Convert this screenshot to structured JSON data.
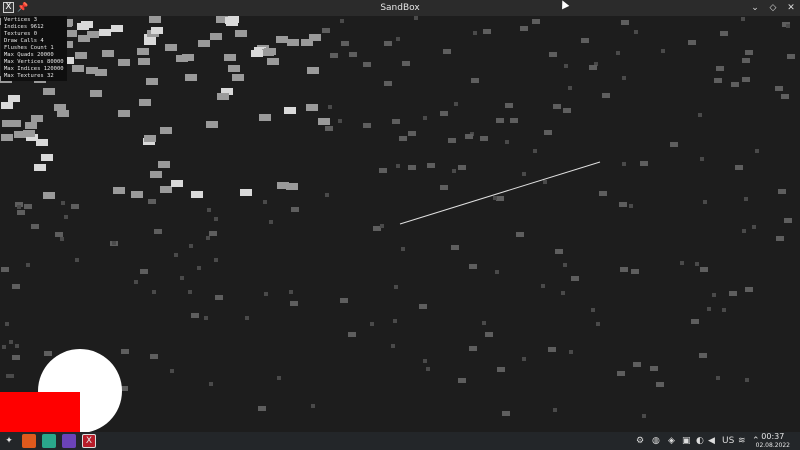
{
  "window": {
    "title": "SandBox",
    "app_icon": "x-app-icon",
    "pin_icon": "pin-icon",
    "controls": {
      "minimize": "⌄",
      "maximize": "◇",
      "close": "✕"
    }
  },
  "stats": [
    "Vertices 3",
    "Indices 9612",
    "Textures 0",
    "Draw Calls 4",
    "Flushes Count 1",
    "Max Quads 20000",
    "Max Vertices 80000",
    "Max Indices 120000",
    "Max Textures 32"
  ],
  "scene": {
    "background_color": "#1d1d1d",
    "line_color": "#e0e0e0",
    "circle_color": "#ffffff",
    "square_color": "#ff0000"
  },
  "taskbar": {
    "launcher_icon": "launcher-icon",
    "apps": [
      "firefox-icon",
      "terminal-icon",
      "notes-icon",
      "sandbox-app-icon"
    ],
    "tray": {
      "keyboard_layout": "US",
      "icons": [
        "settings-icon",
        "discord-icon",
        "security-icon",
        "video-icon",
        "accessibility-icon",
        "volume-icon",
        "network-icon",
        "chevron-up-icon"
      ]
    },
    "clock": {
      "time": "00:37",
      "date": "02.08.2022"
    }
  }
}
